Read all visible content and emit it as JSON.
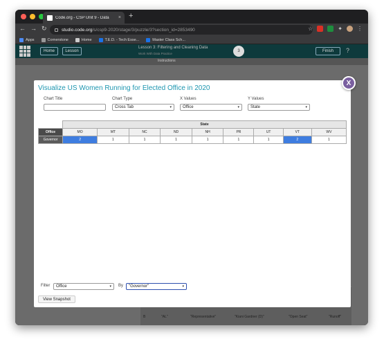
{
  "browser": {
    "tab_title": "Code.org - CSP Unit 9 - Data",
    "tab_close": "×",
    "new_tab": "+",
    "url_host": "studio.code.org",
    "url_path": "/s/csp9-2020/stage/3/puzzle/3?section_id=2853490",
    "bookmarks": [
      {
        "label": "Apps",
        "color": "#4c8bf5"
      },
      {
        "label": "Cornerstone",
        "color": "#999999"
      },
      {
        "label": "Home",
        "color": "#cccccc"
      },
      {
        "label": "T.E.D. - Tech Esse...",
        "color": "#1a73e8"
      },
      {
        "label": "Master Class Sch...",
        "color": "#1a73e8"
      }
    ]
  },
  "app": {
    "home_btn": "Home",
    "lesson_btn": "Lesson",
    "lesson_title": "Lesson 3: Filtering and Cleaning Data",
    "lesson_sub": "Work With Data Practice",
    "level": "3",
    "finish_btn": "Finish",
    "instructions_tab": "Instructions"
  },
  "modal": {
    "title": "Visualize US Women Running for Elected Office in 2020",
    "close_label": "X",
    "chart_title_label": "Chart Title",
    "chart_title_value": "",
    "chart_type_label": "Chart Type",
    "chart_type_value": "Cross Tab",
    "x_values_label": "X Values",
    "x_values_value": "Office",
    "y_values_label": "Y Values",
    "y_values_value": "State",
    "caret": "▾",
    "table": {
      "group_header": "State",
      "row_header": "Office",
      "columns": [
        "MO",
        "MT",
        "NC",
        "ND",
        "NH",
        "PR",
        "UT",
        "VT",
        "WV"
      ],
      "rows": [
        {
          "label": "Governor",
          "values": [
            "2",
            "1",
            "1",
            "1",
            "1",
            "1",
            "1",
            "2",
            "1"
          ]
        }
      ]
    },
    "filter_label": "Filter",
    "filter_value": "Office",
    "by_label": "By",
    "by_value": "\"Governor\"",
    "snapshot_btn": "View Snapshot"
  },
  "background": {
    "cells": [
      "B",
      "\"AL\"",
      "\"Representative\"",
      "\"Kiani Gardner (D)\"",
      "\"Open Seat\"",
      "\"Runoff\""
    ]
  }
}
